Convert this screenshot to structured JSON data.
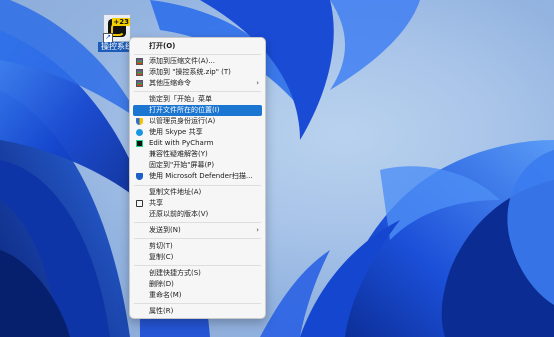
{
  "desktop": {
    "icon": {
      "label": "操控系统",
      "badge": "+23",
      "shortcut_arrow": "↗"
    }
  },
  "context_menu": {
    "items": [
      {
        "label": "打开(O)",
        "icon": "none",
        "bold": true
      },
      {
        "label": "添加到压缩文件(A)...",
        "icon": "winrar-icon"
      },
      {
        "label": "添加到 \"操控系统.zip\" (T)",
        "icon": "winrar-icon"
      },
      {
        "label": "其他压缩命令",
        "icon": "winrar-icon",
        "submenu": true
      },
      {
        "label": "锁定到「开始」菜单",
        "icon": "none"
      },
      {
        "label": "打开文件所在的位置(I)",
        "icon": "none",
        "highlighted": true
      },
      {
        "label": "以管理员身份运行(A)",
        "icon": "uac-shield-icon"
      },
      {
        "label": "使用 Skype 共享",
        "icon": "skype-icon"
      },
      {
        "label": "Edit with PyCharm",
        "icon": "pycharm-icon"
      },
      {
        "label": "兼容性疑难解答(Y)",
        "icon": "none"
      },
      {
        "label": "固定到\"开始\"屏幕(P)",
        "icon": "none"
      },
      {
        "label": "使用 Microsoft Defender扫描...",
        "icon": "defender-icon"
      },
      {
        "label": "复制文件地址(A)",
        "icon": "none"
      },
      {
        "label": "共享",
        "icon": "share-icon"
      },
      {
        "label": "还原以前的版本(V)",
        "icon": "none"
      },
      {
        "label": "发送到(N)",
        "icon": "none",
        "submenu": true
      },
      {
        "label": "剪切(T)",
        "icon": "none"
      },
      {
        "label": "复制(C)",
        "icon": "none"
      },
      {
        "label": "创建快捷方式(S)",
        "icon": "none"
      },
      {
        "label": "删除(D)",
        "icon": "none"
      },
      {
        "label": "重命名(M)",
        "icon": "none"
      },
      {
        "label": "属性(R)",
        "icon": "none"
      }
    ],
    "submenu_arrow": "›"
  },
  "colors": {
    "highlight": "#1b76d1",
    "wallpaper_bg": "#a9c4e8",
    "bloom_dark": "#0b2f9c",
    "bloom_mid": "#1647d6",
    "bloom_light": "#3a7bf0"
  }
}
